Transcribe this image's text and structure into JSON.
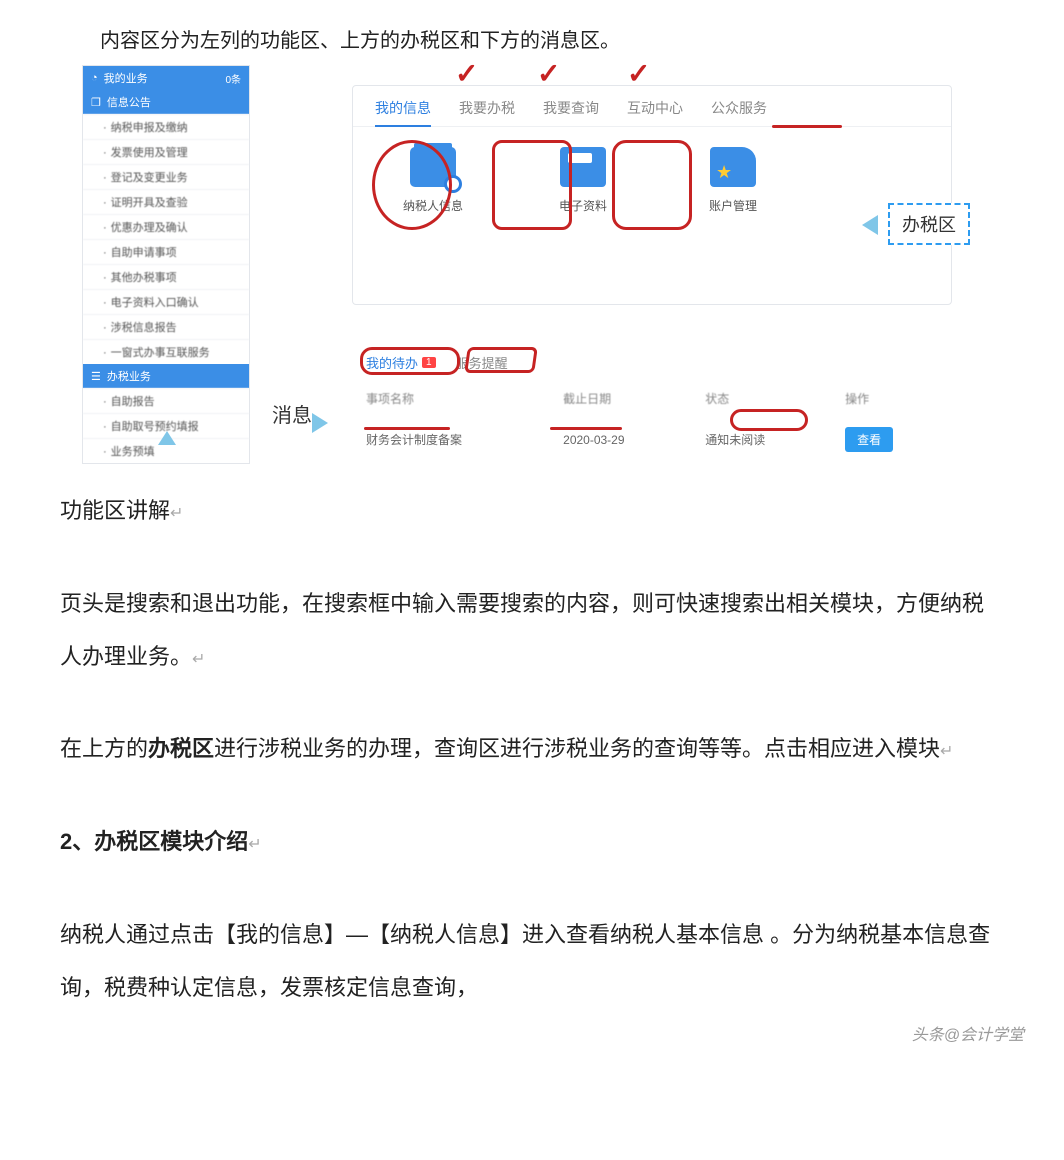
{
  "intro": "内容区分为左列的功能区、上方的办税区和下方的消息区。",
  "sidebar": {
    "header1": "我的业务",
    "header1_badge": "0条",
    "header2": "信息公告",
    "header3": "办税业务",
    "items1": [
      "纳税申报及缴纳",
      "发票使用及管理",
      "登记及变更业务",
      "证明开具及查验",
      "优惠办理及确认",
      "自助申请事项",
      "其他办税事项",
      "电子资料入口确认",
      "涉税信息报告",
      "一窗式办事互联服务"
    ],
    "items2": [
      "自助报告",
      "自助取号预约填报",
      "业务预填"
    ]
  },
  "main": {
    "tabs": [
      "我的信息",
      "我要办税",
      "我要查询",
      "互动中心",
      "公众服务"
    ],
    "icons": [
      {
        "label": "纳税人信息"
      },
      {
        "label": "电子资料"
      },
      {
        "label": "账户管理"
      }
    ]
  },
  "msg": {
    "tabs": [
      {
        "label": "我的待办",
        "badge": "1"
      },
      {
        "label": "服务提醒"
      }
    ],
    "headers": [
      "事项名称",
      "截止日期",
      "状态",
      "操作"
    ],
    "row": {
      "name": "财务会计制度备案",
      "date": "2020-03-29",
      "status": "通知未阅读",
      "btn": "查看"
    }
  },
  "callouts": {
    "tax_area": "办税区",
    "msg_area": "消息"
  },
  "article": {
    "h1": "功能区讲解",
    "p1": "页头是搜索和退出功能，在搜索框中输入需要搜索的内容，则可快速搜索出相关模块，方便纳税人办理业务。",
    "p2a": "在上方的",
    "p2b": "办税区",
    "p2c": "进行涉税业务的办理，查询区进行涉税业务的查询等等。点击相应进入模块",
    "h2": "2、办税区模块介绍",
    "p3": "纳税人通过点击【我的信息】—【纳税人信息】进入查看纳税人基本信息 。分为纳税基本信息查询，税费种认定信息，发票核定信息查询，"
  },
  "watermark": "头条@会计学堂"
}
